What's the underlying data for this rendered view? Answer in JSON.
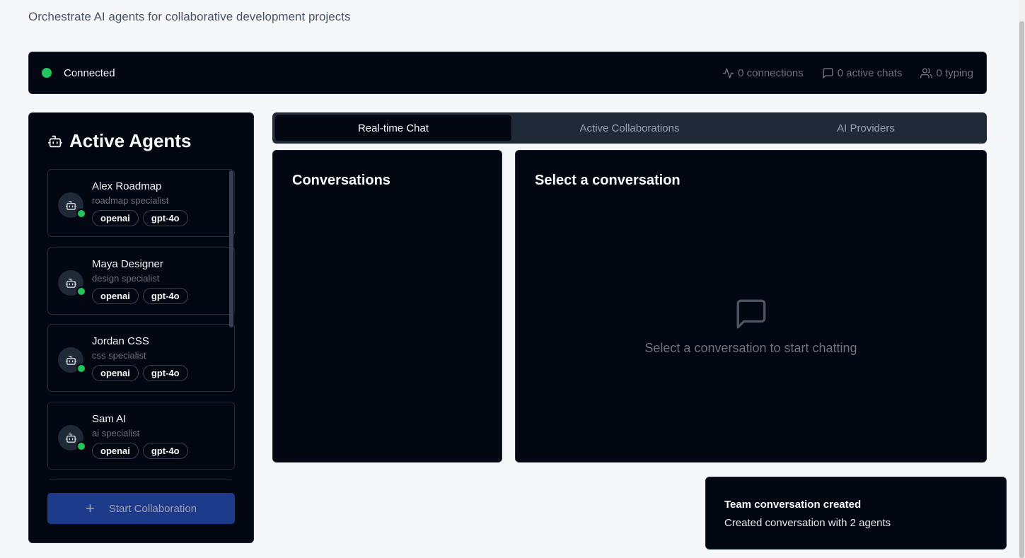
{
  "header": {
    "title": "",
    "subtitle": "Orchestrate AI agents for collaborative development projects"
  },
  "status": {
    "connection": "Connected",
    "connections": "0 connections",
    "active_chats": "0 active chats",
    "typing": "0 typing"
  },
  "sidebar": {
    "title": "Active Agents",
    "agents": [
      {
        "name": "Alex Roadmap",
        "role": "roadmap specialist",
        "provider": "openai",
        "model": "gpt-4o"
      },
      {
        "name": "Maya Designer",
        "role": "design specialist",
        "provider": "openai",
        "model": "gpt-4o"
      },
      {
        "name": "Jordan CSS",
        "role": "css specialist",
        "provider": "openai",
        "model": "gpt-4o"
      },
      {
        "name": "Sam AI",
        "role": "ai specialist",
        "provider": "openai",
        "model": "gpt-4o"
      }
    ],
    "start_button": "Start Collaboration"
  },
  "tabs": [
    "Real-time Chat",
    "Active Collaborations",
    "AI Providers"
  ],
  "conversations": {
    "title": "Conversations"
  },
  "chat": {
    "title": "Select a conversation",
    "empty_text": "Select a conversation to start chatting"
  },
  "toast": {
    "title": "Team conversation created",
    "description": "Created conversation with 2 agents"
  },
  "colors": {
    "panel_bg": "#030712",
    "online": "#22c55e",
    "primary_button": "#1e3a8a"
  },
  "icons": {
    "connections": "activity-icon",
    "chats": "message-square-icon",
    "typing": "users-icon",
    "agent": "bot-icon",
    "empty": "message-square-icon",
    "start": "plus-icon"
  }
}
